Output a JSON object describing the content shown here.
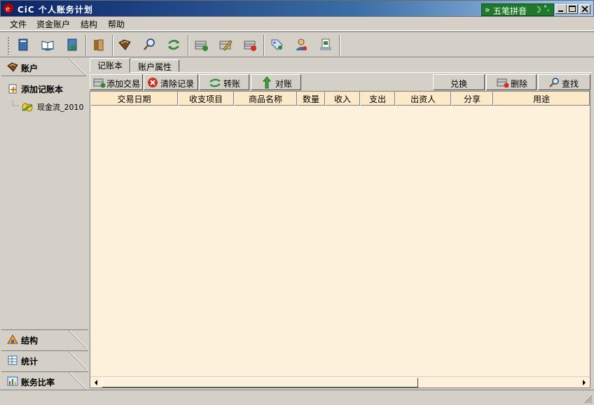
{
  "window": {
    "title": "CiC 个人账务计划"
  },
  "ime": {
    "label": "五笔拼音",
    "accent": "#1e7a2a"
  },
  "menu": [
    {
      "label": "文件"
    },
    {
      "label": "资金账户"
    },
    {
      "label": "结构"
    },
    {
      "label": "帮助"
    }
  ],
  "toolbar": {
    "icons": [
      "ledger-blue-icon",
      "open-book-icon",
      "save-book-icon",
      "bookshelf-icon",
      "journal-icon",
      "magnifier-icon",
      "transfer-arrows-icon",
      "add-row-icon",
      "edit-row-icon",
      "delete-row-icon",
      "tag-icon",
      "user-icon",
      "report-icon"
    ]
  },
  "left_panel": {
    "accounts_header": "账户",
    "add_ledger_label": "添加记账本",
    "ledger_item": "现金流_2010",
    "structure_header": "结构",
    "statistics_header": "统计",
    "ratio_header": "账务比率"
  },
  "tabs": [
    {
      "label": "记账本"
    },
    {
      "label": "账户属性"
    }
  ],
  "actions": {
    "add_transaction": "添加交易",
    "clear_records": "清除记录",
    "transfer": "转账",
    "reconcile": "对账",
    "exchange": "兑换",
    "delete": "删除",
    "find": "查找"
  },
  "table": {
    "columns": [
      "交易日期",
      "收支项目",
      "商品名称",
      "数量",
      "收入",
      "支出",
      "出资人",
      "分享",
      "用途"
    ],
    "rows": []
  },
  "colors": {
    "grid_background": "#fdf1dc",
    "header_background": "#fbe9c7",
    "title_gradient_start": "#0a246a"
  }
}
